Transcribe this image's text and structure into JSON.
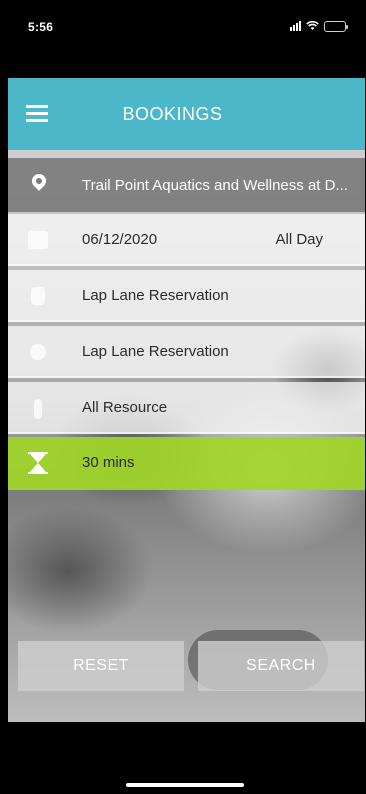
{
  "status_bar": {
    "time": "5:56"
  },
  "header": {
    "title": "BOOKINGS"
  },
  "form": {
    "location": "Trail Point Aquatics and Wellness at D...",
    "date": "06/12/2020",
    "time_range": "All Day",
    "category": "Lap Lane Reservation",
    "activity": "Lap Lane Reservation",
    "resource": "All Resource",
    "duration": "30 mins"
  },
  "buttons": {
    "reset": "RESET",
    "search": "SEARCH"
  },
  "icons": {
    "location": "location-pin-icon",
    "date": "calendar-icon",
    "category": "document-icon",
    "activity": "gear-icon",
    "resource": "person-icon",
    "duration": "hourglass-icon"
  },
  "colors": {
    "header": "#4bb7c8",
    "duration_row": "#a0d628",
    "location_row": "#787878"
  }
}
